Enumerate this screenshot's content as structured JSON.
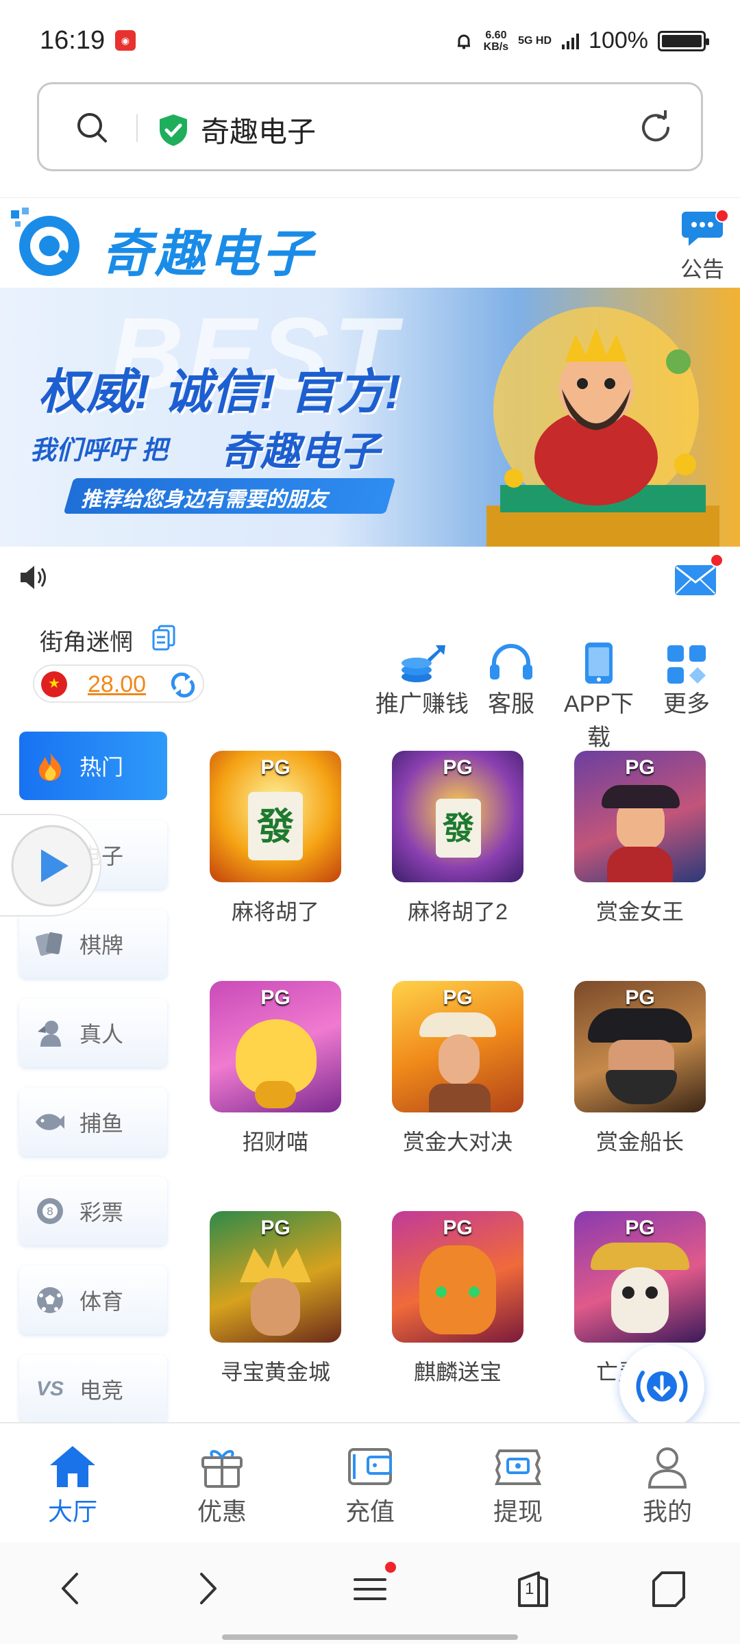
{
  "status": {
    "time": "16:19",
    "speed_top": "6.60",
    "speed_unit": "KB/s",
    "net": "5G HD",
    "battery": "100%"
  },
  "url": {
    "site": "奇趣电子"
  },
  "header": {
    "brand": "奇趣电子",
    "notice_label": "公告"
  },
  "banner": {
    "bg_word": "BEST",
    "headline": "权威! 诚信! 官方!",
    "line1": "我们呼吁 把",
    "line1_brand": "奇趣电子",
    "pill": "推荐给您身边有需要的朋友"
  },
  "user": {
    "name": "街角迷惘",
    "balance": "28.00"
  },
  "quick": [
    {
      "label": "推广赚钱",
      "icon": "share-coins-icon"
    },
    {
      "label": "客服",
      "icon": "headset-icon"
    },
    {
      "label": "APP下载",
      "icon": "phone-icon"
    },
    {
      "label": "更多",
      "icon": "grid-icon"
    }
  ],
  "sidebar": [
    {
      "label": "热门",
      "icon": "fire-icon"
    },
    {
      "label": "电子",
      "icon": "slot-icon"
    },
    {
      "label": "棋牌",
      "icon": "cards-icon"
    },
    {
      "label": "真人",
      "icon": "dealer-icon"
    },
    {
      "label": "捕鱼",
      "icon": "fish-icon"
    },
    {
      "label": "彩票",
      "icon": "lottery-ball-icon"
    },
    {
      "label": "体育",
      "icon": "soccer-ball-icon"
    },
    {
      "label": "电竞",
      "icon": "vs-icon"
    }
  ],
  "games": [
    {
      "name": "麻将胡了",
      "brand": "PG"
    },
    {
      "name": "麻将胡了2",
      "brand": "PG"
    },
    {
      "name": "赏金女王",
      "brand": "PG"
    },
    {
      "name": "招财喵",
      "brand": "PG"
    },
    {
      "name": "赏金大对决",
      "brand": "PG"
    },
    {
      "name": "赏金船长",
      "brand": "PG"
    },
    {
      "name": "寻宝黄金城",
      "brand": "PG"
    },
    {
      "name": "麒麟送宝",
      "brand": "PG"
    },
    {
      "name": "亡灵大盗",
      "brand": "PG"
    }
  ],
  "tabs": [
    {
      "label": "大厅",
      "icon": "home-icon"
    },
    {
      "label": "优惠",
      "icon": "gift-icon"
    },
    {
      "label": "充值",
      "icon": "wallet-icon"
    },
    {
      "label": "提现",
      "icon": "cash-icon"
    },
    {
      "label": "我的",
      "icon": "user-icon"
    }
  ],
  "browser": {
    "tab_count": "1"
  },
  "colors": {
    "accent": "#1a73e8",
    "brand": "#1a8ce8",
    "balance": "#f0871a",
    "badge": "#f0242a"
  }
}
